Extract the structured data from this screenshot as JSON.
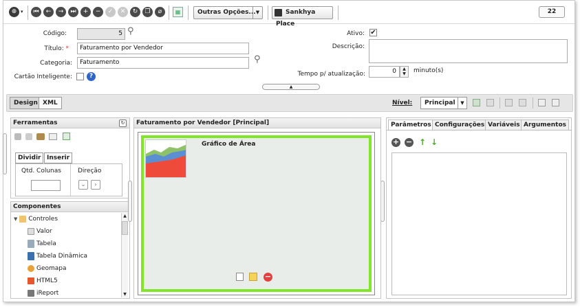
{
  "toolbar": {
    "other_options_label": "Outras Opções...",
    "place_label": "Sankhya Place",
    "badge_count": "22"
  },
  "form": {
    "codigo_label": "Código:",
    "codigo_value": "5",
    "titulo_label": "Título:",
    "required_mark": "*",
    "titulo_value": "Faturamento por Vendedor",
    "categoria_label": "Categoria:",
    "categoria_value": "Faturamento",
    "cartao_label": "Cartão Inteligente:",
    "ativo_label": "Ativo:",
    "ativo_checked": "✔",
    "descricao_label": "Descrição:",
    "tempo_label": "Tempo p/ atualização:",
    "tempo_value": "0",
    "tempo_unit": "minuto(s)",
    "help_glyph": "?"
  },
  "design_bar": {
    "design_tab": "Design",
    "xml_tab": "XML",
    "nivel_label": "Nível:",
    "nivel_value": "Principal"
  },
  "ferramentas": {
    "title": "Ferramentas",
    "tab_dividir": "Dividir",
    "tab_inserir": "Inserir",
    "qtd_colunas_label": "Qtd. Colunas",
    "direcao_label": "Direção"
  },
  "componentes": {
    "title": "Componentes",
    "group": "Controles",
    "items": [
      "Valor",
      "Tabela",
      "Tabela Dinâmica",
      "Geomapa",
      "HTML5",
      "iReport"
    ]
  },
  "canvas": {
    "title": "Faturamento por Vendedor [Principal]",
    "chart_label": "Gráfico de Área"
  },
  "right_panel": {
    "tabs": [
      "Parâmetros",
      "Configurações",
      "Variáveis",
      "Argumentos"
    ]
  }
}
